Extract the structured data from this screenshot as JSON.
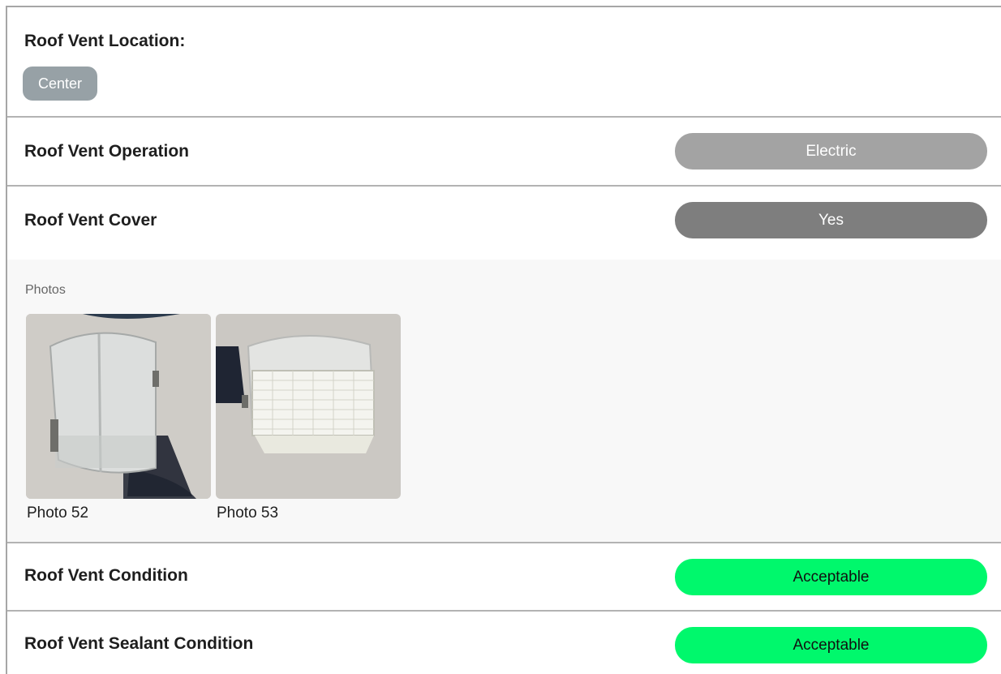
{
  "location": {
    "label": "Roof Vent Location:",
    "value": "Center"
  },
  "operation": {
    "label": "Roof Vent Operation",
    "value": "Electric"
  },
  "cover": {
    "label": "Roof Vent Cover",
    "value": "Yes"
  },
  "photos": {
    "title": "Photos",
    "items": [
      {
        "caption": "Photo 52",
        "subject": "roof vent cover closed"
      },
      {
        "caption": "Photo 53",
        "subject": "roof vent cover with louvered side"
      }
    ]
  },
  "condition": {
    "label": "Roof Vent Condition",
    "value": "Acceptable"
  },
  "sealant": {
    "label": "Roof Vent Sealant Condition",
    "value": "Acceptable"
  },
  "colors": {
    "chip_gray": "#97a1a6",
    "electric_gray": "#a3a3a3",
    "yes_gray": "#7e7e7e",
    "acceptable_green": "#00f86c"
  }
}
